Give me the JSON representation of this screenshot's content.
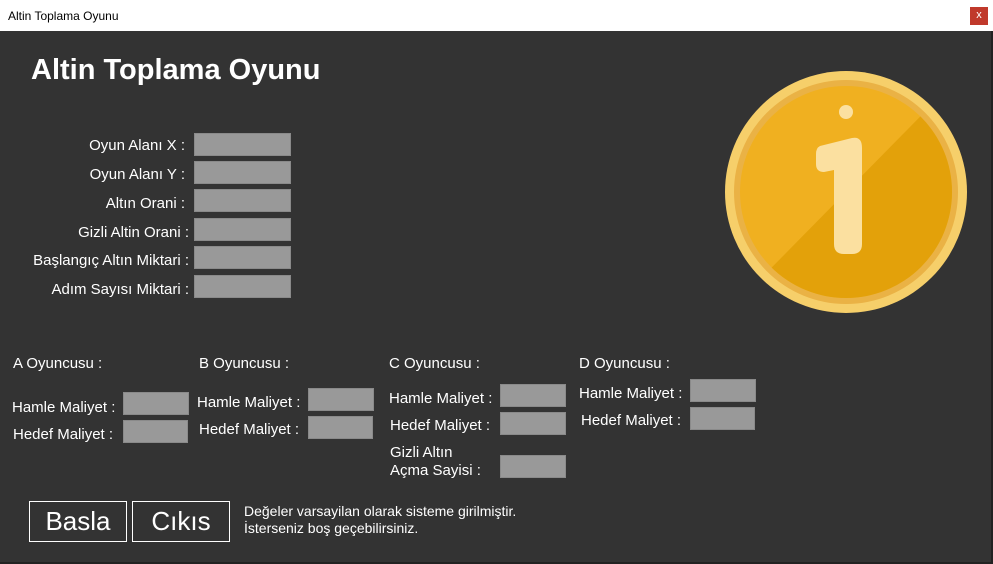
{
  "window": {
    "title": "Altin Toplama Oyunu",
    "close_label": "x",
    "close_color": "#c0392b"
  },
  "heading": "Altin Toplama Oyunu",
  "settings": {
    "x_label": "Oyun Alanı X :",
    "y_label": "Oyun Alanı Y :",
    "gold_ratio_label": "Altın Orani :",
    "hidden_gold_ratio_label": "Gizli Altin Orani :",
    "start_gold_label": "Başlangıç Altın Miktari :",
    "step_count_label": "Adım Sayısı Miktari :"
  },
  "players": {
    "a": {
      "title": "A Oyuncusu :",
      "move_cost_label": "Hamle Maliyet :",
      "target_cost_label": "Hedef Maliyet :"
    },
    "b": {
      "title": "B Oyuncusu :",
      "move_cost_label": "Hamle Maliyet :",
      "target_cost_label": "Hedef Maliyet :"
    },
    "c": {
      "title": "C Oyuncusu :",
      "move_cost_label": "Hamle Maliyet :",
      "target_cost_label": "Hedef Maliyet :",
      "reveal_label_1": "Gizli Altın",
      "reveal_label_2": "Açma Sayisi :"
    },
    "d": {
      "title": "D Oyuncusu :",
      "move_cost_label": "Hamle Maliyet :",
      "target_cost_label": "Hedef Maliyet :"
    }
  },
  "buttons": {
    "start": "Basla",
    "exit": "Cıkıs"
  },
  "note": {
    "line1": "Değeler varsayilan olarak sisteme girilmiştir.",
    "line2": "İsterseniz boş geçebilirsiniz."
  },
  "coin": {
    "icon": "gold-coin-number-one",
    "numeral": "1",
    "colors": {
      "rim": "#f6cf6a",
      "face": "#f0b020",
      "shade": "#e3a10a",
      "numeral": "#fbe0a0"
    }
  }
}
